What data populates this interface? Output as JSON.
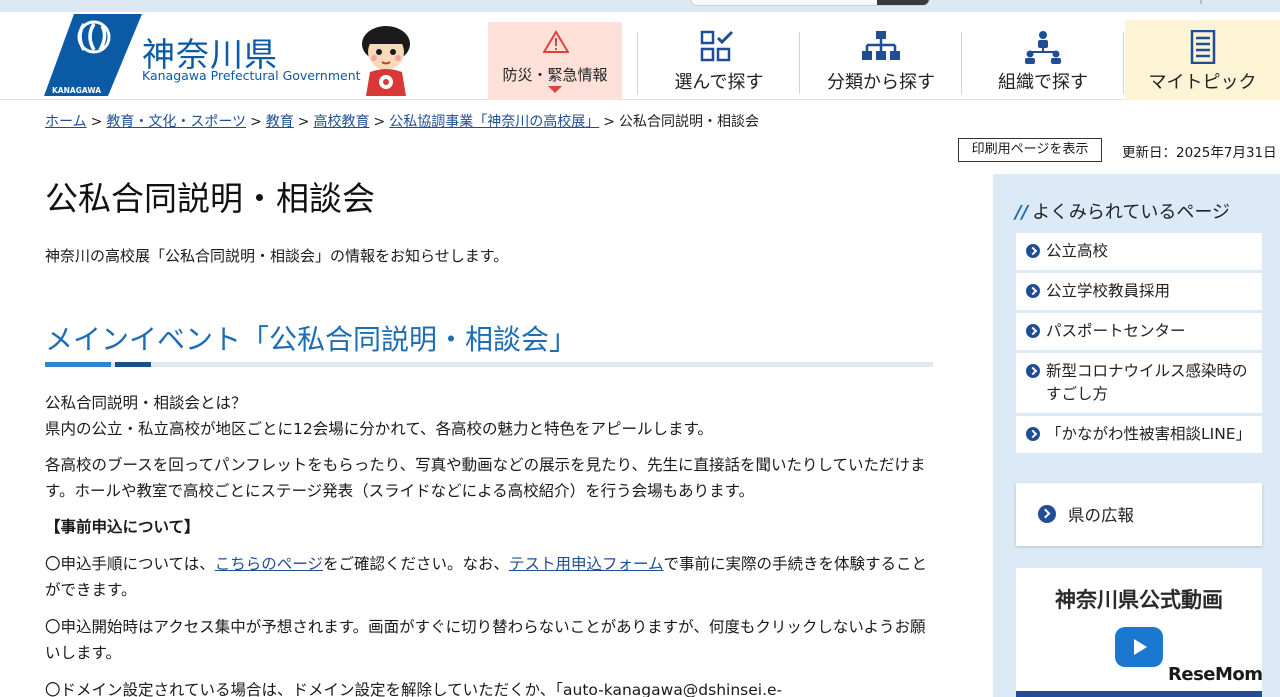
{
  "header": {
    "site_title": "神奈川県",
    "site_subtitle": "Kanagawa Prefectural Government",
    "logo_caption": "KANAGAWA",
    "emergency_label": "防災・緊急情報",
    "nav": [
      {
        "label": "選んで探す",
        "icon": "checklist-grid-icon"
      },
      {
        "label": "分類から探す",
        "icon": "hierarchy-icon"
      },
      {
        "label": "組織で探す",
        "icon": "people-org-icon"
      },
      {
        "label": "マイトピック",
        "icon": "document-list-icon"
      }
    ]
  },
  "breadcrumb": {
    "items": [
      "ホーム",
      "教育・文化・スポーツ",
      "教育",
      "高校教育",
      "公私協調事業「神奈川の高校展」"
    ],
    "current": "公私合同説明・相談会"
  },
  "tools": {
    "print_label": "印刷用ページを表示",
    "updated": "更新日：2025年7月31日"
  },
  "main": {
    "title": "公私合同説明・相談会",
    "lead": "神奈川の高校展「公私合同説明・相談会」の情報をお知らせします。",
    "section_title": "メインイベント「公私合同説明・相談会」",
    "p1_line1": "公私合同説明・相談会とは？",
    "p1_line2": "県内の公立・私立高校が地区ごとに12会場に分かれて、各高校の魅力と特色をアピールします。",
    "p2": "各高校のブースを回ってパンフレットをもらったり、写真や動画などの展示を見たり、先生に直接話を聞いたりしていただけます。ホールや教室で高校ごとにステージ発表（スライドなどによる高校紹介）を行う会場もあります。",
    "subhead": "【事前申込について】",
    "p3_a": "〇申込手順については、",
    "p3_link1": "こちらのページ",
    "p3_b": "をご確認ください。なお、",
    "p3_link2": "テスト用申込フォーム",
    "p3_c": "で事前に実際の手続きを体験することができます。",
    "p4": "〇申込開始時はアクセス集中が予想されます。画面がすぐに切り替わらないことがありますが、何度もクリックしないようお願いします。",
    "p5": "〇ドメイン設定されている場合は、ドメイン設定を解除していただくか、「auto-kanagawa@dshinsei.e-"
  },
  "sidebar": {
    "popular_heading": "よくみられているページ",
    "popular_items": [
      "公立高校",
      "公立学校教員採用",
      "パスポートセンター",
      "新型コロナウイルス感染時のすごし方",
      "「かながわ性被害相談LINE」"
    ],
    "koho_label": "県の広報",
    "video_title": "神奈川県公式動画"
  },
  "watermark": "ReseMom",
  "colors": {
    "brand_blue": "#0b5aa6",
    "link": "#1f4e96",
    "emergency_bg": "#fde1d9",
    "sidebar_bg": "#dce9f7"
  }
}
